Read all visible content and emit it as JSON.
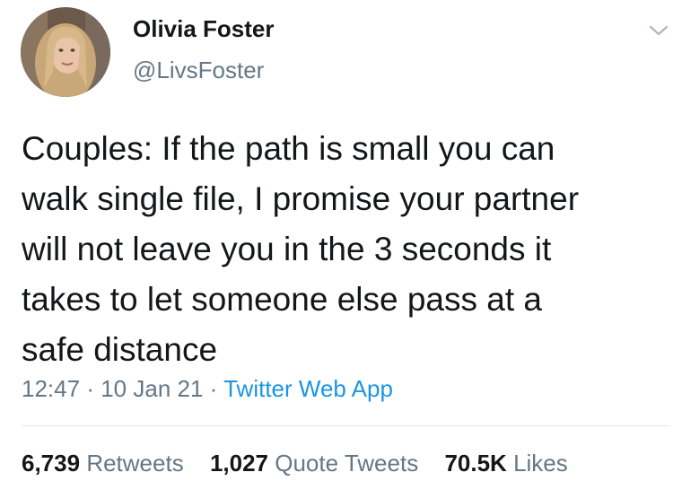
{
  "author": {
    "display_name": "Olivia Foster",
    "handle": "@LivsFoster"
  },
  "tweet": {
    "text": "Couples: If the path is small you can\nwalk single file, I promise your partner\nwill not leave you in the 3 seconds it\ntakes to let someone else pass at a\nsafe distance",
    "time": "12:47",
    "separator": "·",
    "date": "10 Jan 21",
    "source": "Twitter Web App"
  },
  "stats": {
    "retweets_count": "6,739",
    "retweets_label": "Retweets",
    "quotes_count": "1,027",
    "quotes_label": "Quote Tweets",
    "likes_count": "70.5K",
    "likes_label": "Likes"
  },
  "icons": {
    "menu": "chevron-down-icon"
  },
  "colors": {
    "text_primary": "#14171a",
    "text_secondary": "#657786",
    "link": "#1b95e0",
    "divider": "#e1e8ed"
  }
}
